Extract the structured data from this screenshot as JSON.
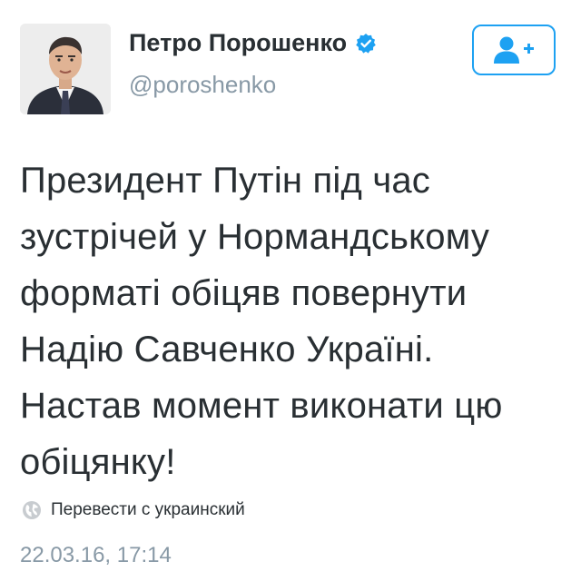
{
  "author": {
    "name": "Петро Порошенко",
    "handle": "@poroshenko",
    "verified": true,
    "avatar_icon": "profile-photo"
  },
  "follow_button": {
    "icon": "add-user-icon",
    "color": "#1da1f2"
  },
  "tweet": {
    "lines": [
      "Президент Путін під час",
      "зустрічей у Нормандському",
      "форматі обіцяв повернути",
      "Надію Савченко Україні.",
      "Настав момент виконати цю",
      "обіцянку!"
    ],
    "translate_label": "Перевести с украинский",
    "translate_icon": "globe-icon",
    "timestamp": "22.03.16, 17:14"
  },
  "colors": {
    "text": "#292f33",
    "secondary": "#8899a6",
    "accent": "#1da1f2",
    "verified_badge": "#1da1f2"
  }
}
